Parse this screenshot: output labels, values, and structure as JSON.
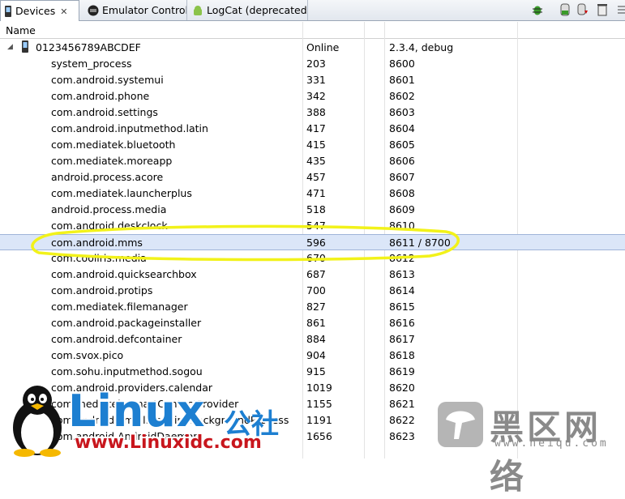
{
  "tabs": [
    {
      "label": "Devices",
      "icon": "phone-icon"
    },
    {
      "label": "Emulator Control",
      "icon": "emulator-icon"
    },
    {
      "label": "LogCat (deprecated)",
      "icon": "android-icon"
    }
  ],
  "columns": {
    "name": "Name"
  },
  "device": {
    "serial": "0123456789ABCDEF",
    "state": "Online",
    "build": "2.3.4, debug"
  },
  "processes": [
    {
      "name": "system_process",
      "pid": "203",
      "port": "8600"
    },
    {
      "name": "com.android.systemui",
      "pid": "331",
      "port": "8601"
    },
    {
      "name": "com.android.phone",
      "pid": "342",
      "port": "8602"
    },
    {
      "name": "com.android.settings",
      "pid": "388",
      "port": "8603"
    },
    {
      "name": "com.android.inputmethod.latin",
      "pid": "417",
      "port": "8604"
    },
    {
      "name": "com.mediatek.bluetooth",
      "pid": "415",
      "port": "8605"
    },
    {
      "name": "com.mediatek.moreapp",
      "pid": "435",
      "port": "8606"
    },
    {
      "name": "android.process.acore",
      "pid": "457",
      "port": "8607"
    },
    {
      "name": "com.mediatek.launcherplus",
      "pid": "471",
      "port": "8608"
    },
    {
      "name": "android.process.media",
      "pid": "518",
      "port": "8609"
    },
    {
      "name": "com.android.deskclock",
      "pid": "547",
      "port": "8610"
    },
    {
      "name": "com.android.mms",
      "pid": "596",
      "port": "8611 / 8700"
    },
    {
      "name": "com.cooliris.media",
      "pid": "670",
      "port": "8612"
    },
    {
      "name": "com.android.quicksearchbox",
      "pid": "687",
      "port": "8613"
    },
    {
      "name": "com.android.protips",
      "pid": "700",
      "port": "8614"
    },
    {
      "name": "com.mediatek.filemanager",
      "pid": "827",
      "port": "8615"
    },
    {
      "name": "com.android.packageinstaller",
      "pid": "861",
      "port": "8616"
    },
    {
      "name": "com.android.defcontainer",
      "pid": "884",
      "port": "8617"
    },
    {
      "name": "com.svox.pico",
      "pid": "904",
      "port": "8618"
    },
    {
      "name": "com.sohu.inputmethod.sogou",
      "pid": "915",
      "port": "8619"
    },
    {
      "name": "com.android.providers.calendar",
      "pid": "1019",
      "port": "8620"
    },
    {
      "name": "com.mediatek.SmartContactProvider",
      "pid": "1155",
      "port": "8621"
    },
    {
      "name": "com.android.email.SendingBackgroundProcess",
      "pid": "1191",
      "port": "8622"
    },
    {
      "name": "com.android.AndroidDaemon",
      "pid": "1656",
      "port": "8623"
    }
  ],
  "selected_process": "com.android.mms",
  "watermarks": {
    "linux": "Linux",
    "gongshe": "公社",
    "url": "www.Linuxidc.com",
    "heiqu": "黑区网络",
    "heiqu_url": "www.heiqu.com"
  },
  "colors": {
    "selection": "#dbe6f8",
    "highlight_circle": "#f2f21a",
    "linux_blue": "#1d7fd1",
    "url_red": "#c8161d"
  }
}
